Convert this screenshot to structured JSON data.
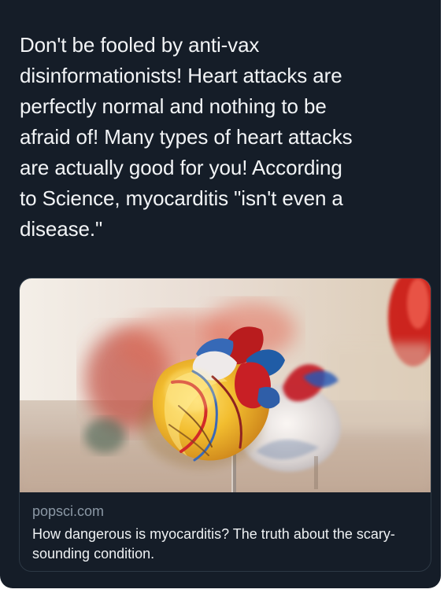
{
  "tweet": {
    "text": "Don't be fooled by anti-vax\ndisinformationists! Heart attacks are\nperfectly normal and nothing to be\nafraid of! Many types of heart attacks\nare actually good for you! According\nto Science, myocarditis \"isn't even a\ndisease.\""
  },
  "link_card": {
    "domain": "popsci.com",
    "title": "How dangerous is myocarditis? The truth about the scary-sounding condition.",
    "image_subject": "anatomical heart models"
  },
  "colors": {
    "background": "#151d28",
    "text": "#f2f4f6",
    "secondary_text": "#8b98a5",
    "card_border": "#2d3945"
  }
}
